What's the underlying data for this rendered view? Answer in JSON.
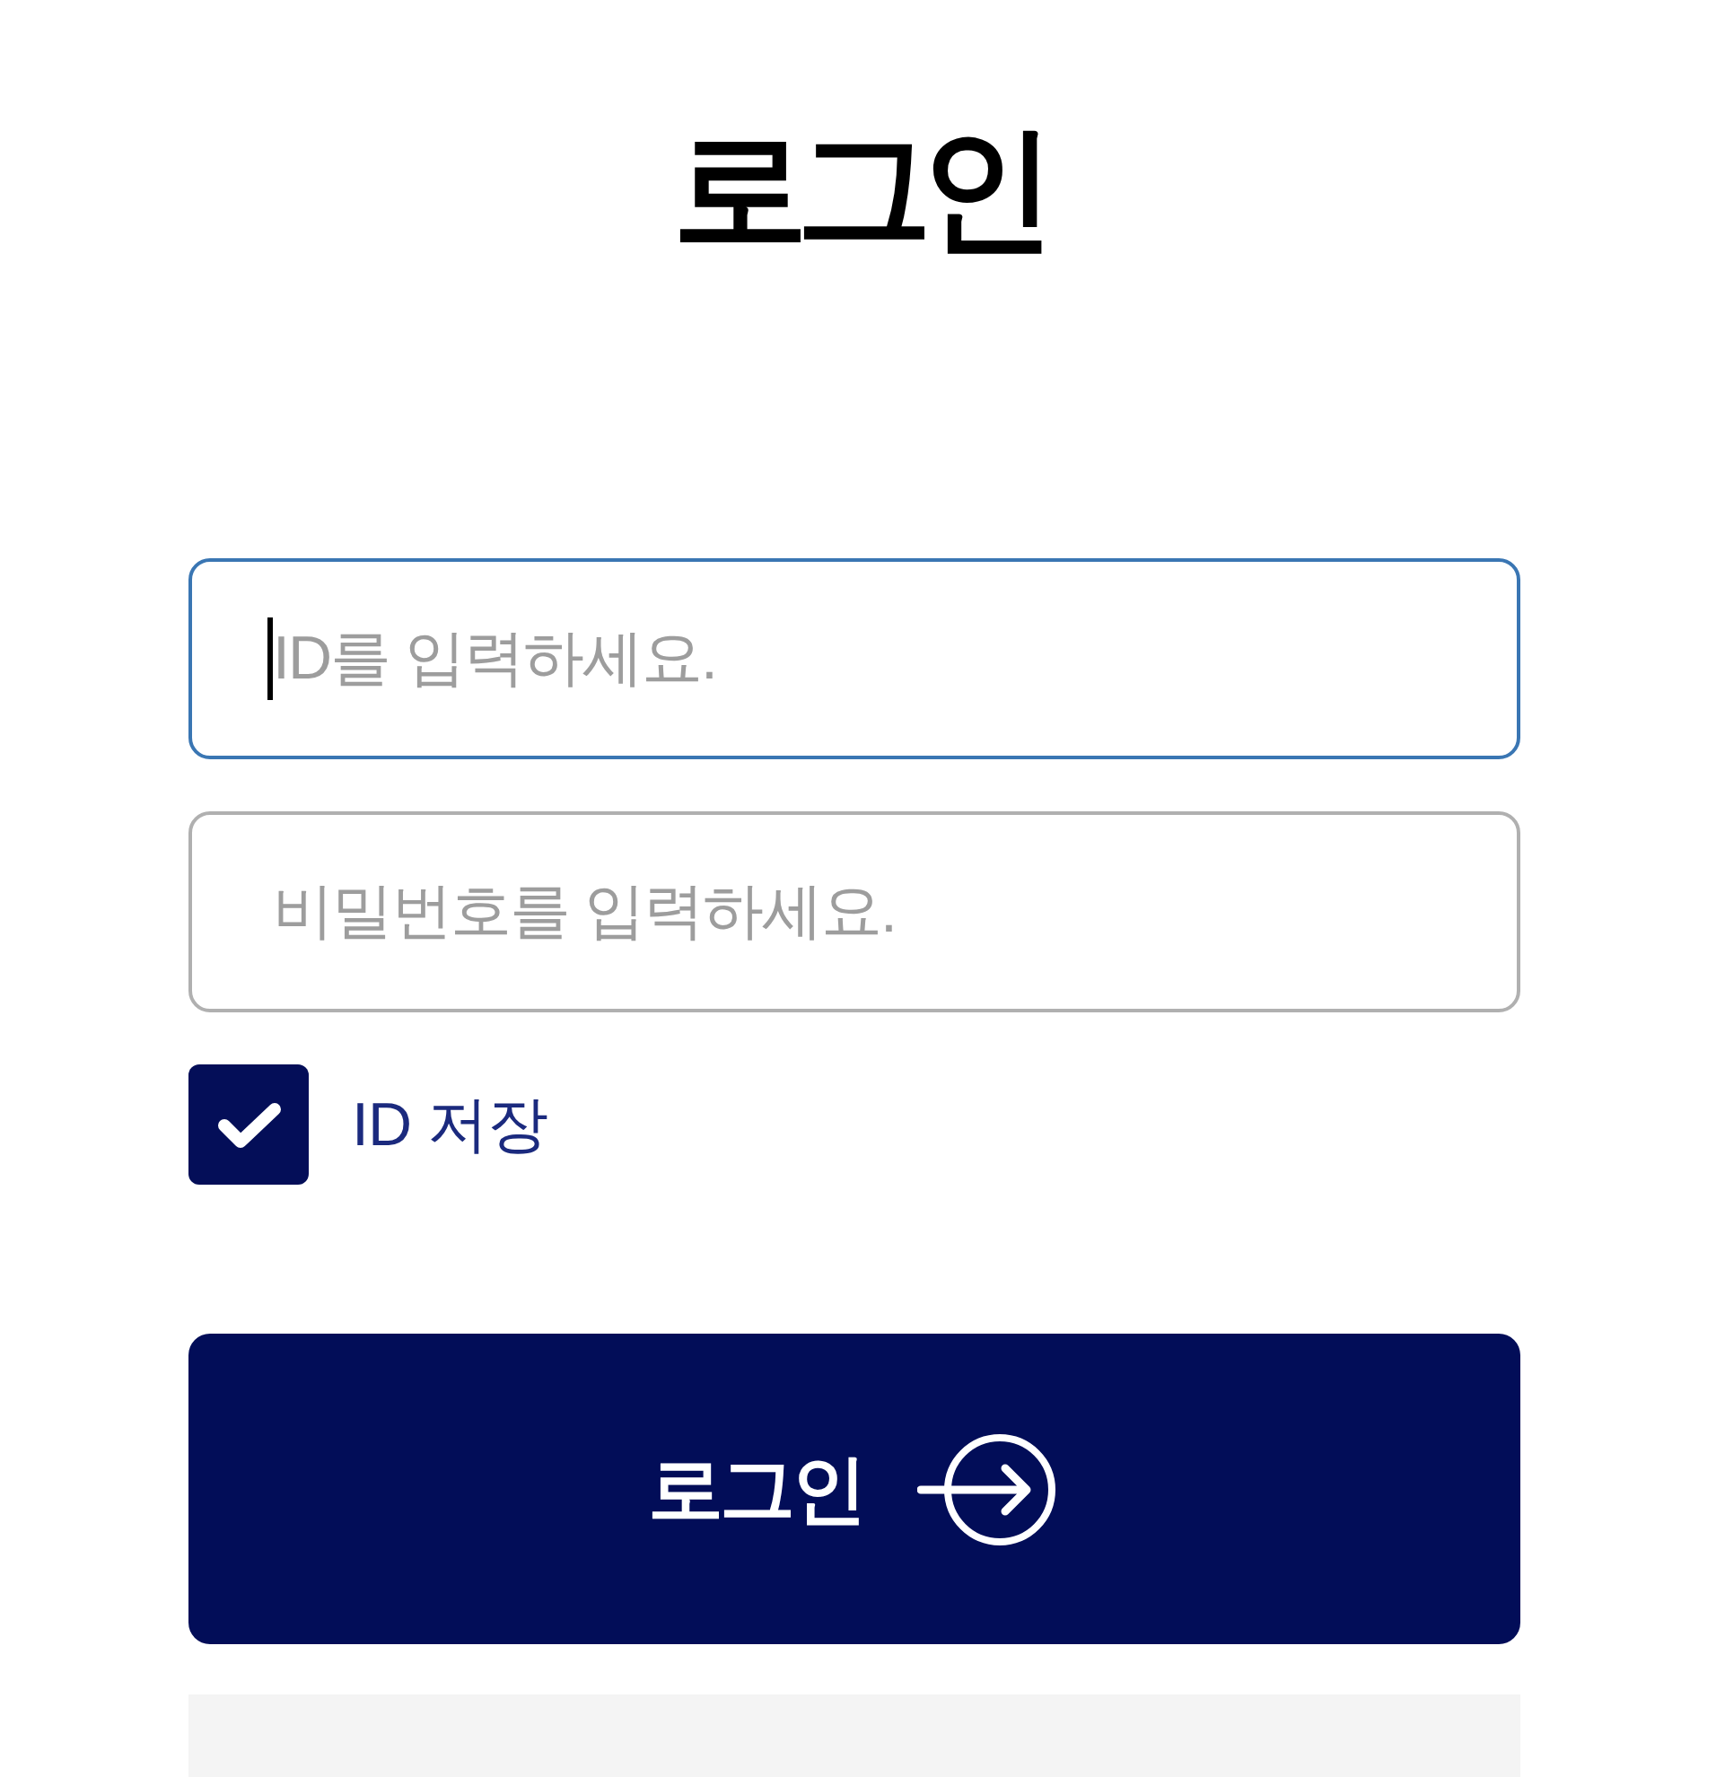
{
  "title": "로그인",
  "id_field": {
    "placeholder": "ID를 입력하세요.",
    "focused": true
  },
  "password_field": {
    "placeholder": "비밀번호를 입력하세요.",
    "focused": false
  },
  "remember_id": {
    "label": "ID 저장",
    "checked": true
  },
  "login_button": {
    "label": "로그인"
  }
}
